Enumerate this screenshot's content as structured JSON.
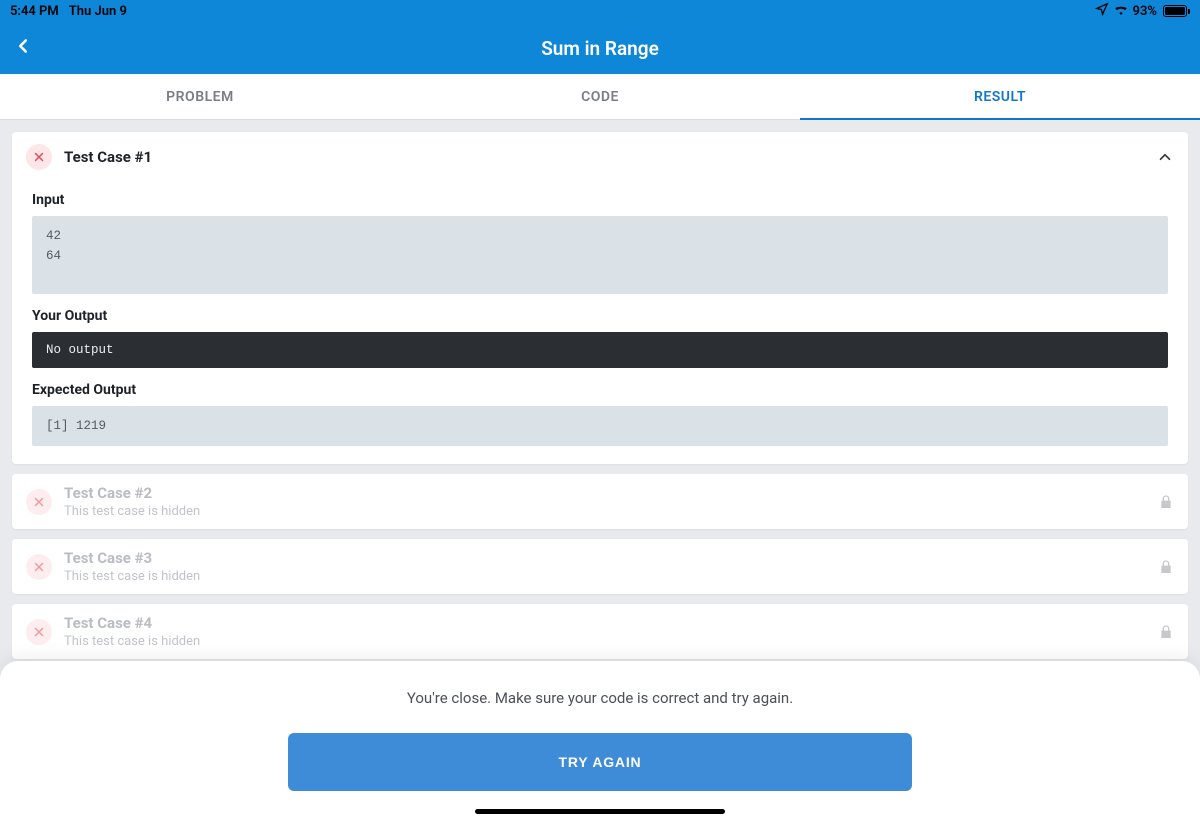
{
  "statusbar": {
    "time": "5:44 PM",
    "date": "Thu Jun 9",
    "battery_pct": "93%"
  },
  "nav": {
    "title": "Sum in Range"
  },
  "tabs": {
    "problem": "PROBLEM",
    "code": "CODE",
    "result": "RESULT",
    "active": "result"
  },
  "test1": {
    "title": "Test Case #1",
    "input_label": "Input",
    "input_value": "42\n64",
    "your_output_label": "Your Output",
    "your_output_value": "No output",
    "expected_label": "Expected Output",
    "expected_value": "[1] 1219"
  },
  "hidden_tests": [
    {
      "title": "Test Case #2",
      "sub": "This test case is hidden"
    },
    {
      "title": "Test Case #3",
      "sub": "This test case is hidden"
    },
    {
      "title": "Test Case #4",
      "sub": "This test case is hidden"
    }
  ],
  "sheet": {
    "message": "You're close. Make sure your code is correct and try again.",
    "button": "TRY AGAIN"
  }
}
